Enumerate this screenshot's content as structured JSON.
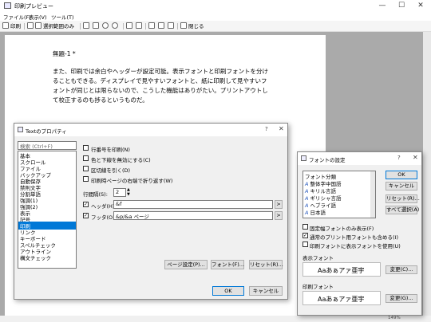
{
  "app": {
    "title": "印刷プレビュー",
    "menu": [
      "ファイル(F)",
      "表示(V)",
      "ツール(T)"
    ],
    "toolbar": {
      "print": "印刷",
      "print_range": "選択範囲のみ",
      "close": "閉じる"
    },
    "zoom": "149%",
    "caption_buttons": {
      "minimize": "—",
      "maximize": "☐",
      "close": "✕"
    }
  },
  "document": {
    "title": "無題-1 *",
    "paragraph": [
      "また、印刷では余白やヘッダーが設定可能。表示フォントと印刷フォントを分け",
      "ることもできる。ディスプレイで見やすいフォントと、紙に印刷して見やすいフ",
      "ォントが同じとは限らないので、こうした機能はありがたい。プリントアウトし",
      "て校正するのも捗るというものだ。"
    ]
  },
  "text_props": {
    "title": "Textのプロパティ",
    "help": "?",
    "close": "✕",
    "search_placeholder": "検索 (Ctrl+F)",
    "categories": [
      "基本",
      "スクロール",
      "ファイル",
      "バックアップ",
      "自動保存",
      "禁則文字",
      "分割単語",
      "強調(1)",
      "強調(2)",
      "表示",
      "記号",
      "印刷",
      "リンク",
      "キーボード",
      "スペルチェック",
      "アウトライン",
      "構文チェック"
    ],
    "selected_category": "印刷",
    "options": {
      "line_numbers": "行番号を印刷(N)",
      "no_colors": "色と下線を無効にする(C)",
      "separator": "区切線を引く(D)",
      "wrap": "印刷時ページの右端で折り返す(W)"
    },
    "line_spacing_label": "行間隔(S):",
    "line_spacing_value": "2",
    "header_label": "ヘッダ(H):",
    "header_value": "&f",
    "footer_label": "フッタ(O):",
    "footer_value": "&p/&a ページ",
    "arrow": ">",
    "page_setup": "ページ設定(P)...",
    "font": "フォント(F)...",
    "reset": "リセット(R)...",
    "ok": "OK",
    "cancel": "キャンセル"
  },
  "font_settings": {
    "title": "フォントの設定",
    "help": "?",
    "close": "✕",
    "category_label": "フォント分類",
    "categories": [
      "整体字中国語",
      "キリル言語",
      "ギリシャ言語",
      "ヘブライ語",
      "日本語"
    ],
    "fixed_only": "固定幅フォントのみ表示(F)",
    "include_print": "通常のプリント用フォントも含める(I)",
    "use_print_font": "印刷フォントに表示フォントを使用(U)",
    "display_font_label": "表示フォント",
    "print_font_label": "印刷フォント",
    "sample": "Aaあぁアァ亜宇",
    "change_display": "変更(C)...",
    "change_print": "変更(G)...",
    "ok": "OK",
    "cancel": "キャンセル",
    "reset": "リセット(R)...",
    "select_all": "すべて選択(A)"
  }
}
